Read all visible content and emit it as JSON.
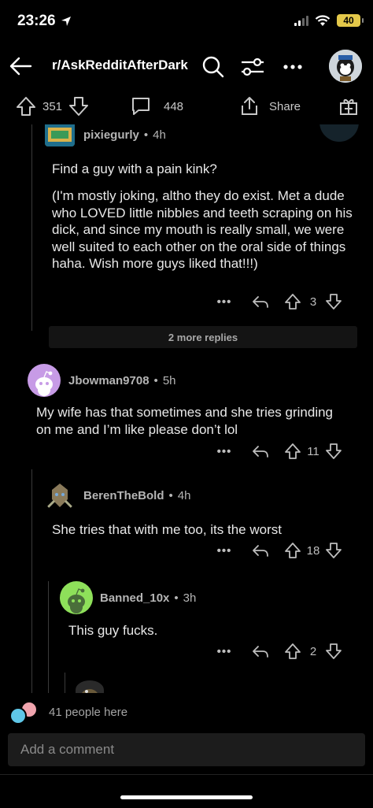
{
  "status": {
    "time": "23:26",
    "battery": "40"
  },
  "header": {
    "subreddit": "r/AskRedditAfterDark"
  },
  "post_actions": {
    "upvotes": "351",
    "comments": "448",
    "share_label": "Share"
  },
  "comments": [
    {
      "user": "pixiegurly",
      "age": "4h",
      "body_1": "Find a guy with a pain kink?",
      "body_2": "(I'm mostly joking, altho they do exist. Met a dude who LOVED little nibbles and teeth scraping on his dick, and since my mouth is really small, we were well suited to each other on the oral side of things haha. Wish more guys liked that!!!)",
      "score": "3"
    },
    {
      "more_replies": "2 more replies"
    },
    {
      "user": "Jbowman9708",
      "age": "5h",
      "body": "My wife has that sometimes and she tries grinding on me and I’m like please don’t lol",
      "score": "11"
    },
    {
      "user": "BerenTheBold",
      "age": "4h",
      "body": "She tries that with me too, its the worst",
      "score": "18"
    },
    {
      "user": "Banned_10x",
      "age": "3h",
      "body": "This guy fucks.",
      "score": "2"
    }
  ],
  "footer": {
    "people_here": "41 people here",
    "comment_placeholder": "Add a comment"
  },
  "colors": {
    "background": "#000000",
    "text": "#e8e8e8",
    "muted": "#b5b5b5",
    "battery": "#e4c84a"
  }
}
